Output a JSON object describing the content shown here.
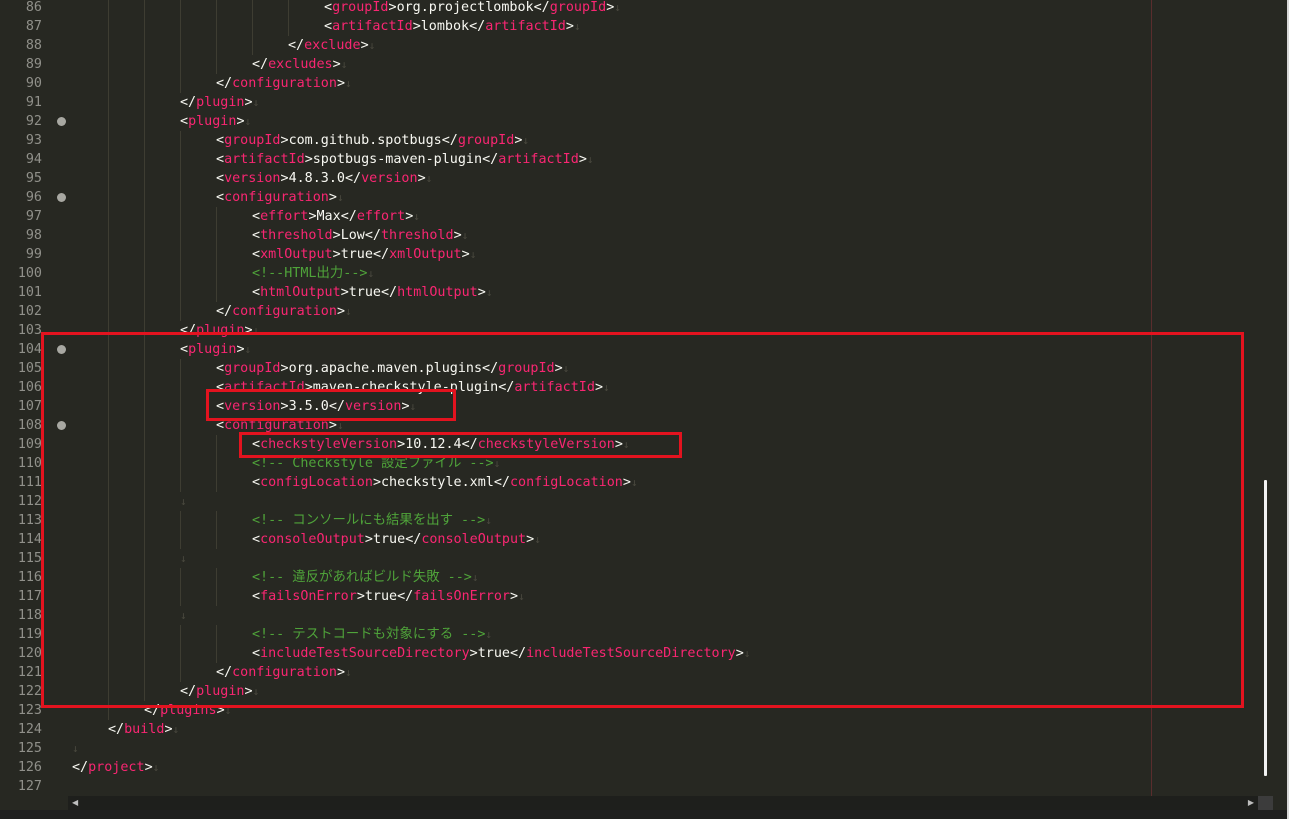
{
  "editor": {
    "lines": [
      {
        "n": "86",
        "indent": 7,
        "tokens": [
          [
            "b",
            "<"
          ],
          [
            "t",
            "groupId"
          ],
          [
            "b",
            ">"
          ],
          [
            "x",
            "org.projectlombok"
          ],
          [
            "b",
            "</"
          ],
          [
            "t",
            "groupId"
          ],
          [
            "b",
            ">"
          ]
        ]
      },
      {
        "n": "87",
        "indent": 7,
        "tokens": [
          [
            "b",
            "<"
          ],
          [
            "t",
            "artifactId"
          ],
          [
            "b",
            ">"
          ],
          [
            "x",
            "lombok"
          ],
          [
            "b",
            "</"
          ],
          [
            "t",
            "artifactId"
          ],
          [
            "b",
            ">"
          ]
        ]
      },
      {
        "n": "88",
        "indent": 6,
        "tokens": [
          [
            "b",
            "</"
          ],
          [
            "t",
            "exclude"
          ],
          [
            "b",
            ">"
          ]
        ]
      },
      {
        "n": "89",
        "indent": 5,
        "tokens": [
          [
            "b",
            "</"
          ],
          [
            "t",
            "excludes"
          ],
          [
            "b",
            ">"
          ]
        ]
      },
      {
        "n": "90",
        "indent": 4,
        "tokens": [
          [
            "b",
            "</"
          ],
          [
            "t",
            "configuration"
          ],
          [
            "b",
            ">"
          ]
        ]
      },
      {
        "n": "91",
        "indent": 3,
        "tokens": [
          [
            "b",
            "</"
          ],
          [
            "t",
            "plugin"
          ],
          [
            "b",
            ">"
          ]
        ]
      },
      {
        "n": "92",
        "indent": 3,
        "fold": true,
        "tokens": [
          [
            "b",
            "<"
          ],
          [
            "t",
            "plugin"
          ],
          [
            "b",
            ">"
          ]
        ]
      },
      {
        "n": "93",
        "indent": 4,
        "tokens": [
          [
            "b",
            "<"
          ],
          [
            "t",
            "groupId"
          ],
          [
            "b",
            ">"
          ],
          [
            "x",
            "com.github.spotbugs"
          ],
          [
            "b",
            "</"
          ],
          [
            "t",
            "groupId"
          ],
          [
            "b",
            ">"
          ]
        ]
      },
      {
        "n": "94",
        "indent": 4,
        "tokens": [
          [
            "b",
            "<"
          ],
          [
            "t",
            "artifactId"
          ],
          [
            "b",
            ">"
          ],
          [
            "x",
            "spotbugs-maven-plugin"
          ],
          [
            "b",
            "</"
          ],
          [
            "t",
            "artifactId"
          ],
          [
            "b",
            ">"
          ]
        ]
      },
      {
        "n": "95",
        "indent": 4,
        "tokens": [
          [
            "b",
            "<"
          ],
          [
            "t",
            "version"
          ],
          [
            "b",
            ">"
          ],
          [
            "x",
            "4.8.3.0"
          ],
          [
            "b",
            "</"
          ],
          [
            "t",
            "version"
          ],
          [
            "b",
            ">"
          ]
        ]
      },
      {
        "n": "96",
        "indent": 4,
        "fold": true,
        "tokens": [
          [
            "b",
            "<"
          ],
          [
            "t",
            "configuration"
          ],
          [
            "b",
            ">"
          ]
        ]
      },
      {
        "n": "97",
        "indent": 5,
        "tokens": [
          [
            "b",
            "<"
          ],
          [
            "t",
            "effort"
          ],
          [
            "b",
            ">"
          ],
          [
            "x",
            "Max"
          ],
          [
            "b",
            "</"
          ],
          [
            "t",
            "effort"
          ],
          [
            "b",
            ">"
          ]
        ]
      },
      {
        "n": "98",
        "indent": 5,
        "tokens": [
          [
            "b",
            "<"
          ],
          [
            "t",
            "threshold"
          ],
          [
            "b",
            ">"
          ],
          [
            "x",
            "Low"
          ],
          [
            "b",
            "</"
          ],
          [
            "t",
            "threshold"
          ],
          [
            "b",
            ">"
          ]
        ]
      },
      {
        "n": "99",
        "indent": 5,
        "tokens": [
          [
            "b",
            "<"
          ],
          [
            "t",
            "xmlOutput"
          ],
          [
            "b",
            ">"
          ],
          [
            "x",
            "true"
          ],
          [
            "b",
            "</"
          ],
          [
            "t",
            "xmlOutput"
          ],
          [
            "b",
            ">"
          ]
        ]
      },
      {
        "n": "100",
        "indent": 5,
        "tokens": [
          [
            "c",
            "<!--HTML出力-->"
          ]
        ]
      },
      {
        "n": "101",
        "indent": 5,
        "tokens": [
          [
            "b",
            "<"
          ],
          [
            "t",
            "htmlOutput"
          ],
          [
            "b",
            ">"
          ],
          [
            "x",
            "true"
          ],
          [
            "b",
            "</"
          ],
          [
            "t",
            "htmlOutput"
          ],
          [
            "b",
            ">"
          ]
        ]
      },
      {
        "n": "102",
        "indent": 4,
        "tokens": [
          [
            "b",
            "</"
          ],
          [
            "t",
            "configuration"
          ],
          [
            "b",
            ">"
          ]
        ]
      },
      {
        "n": "103",
        "indent": 3,
        "tokens": [
          [
            "b",
            "</"
          ],
          [
            "t",
            "plugin"
          ],
          [
            "b",
            ">"
          ]
        ]
      },
      {
        "n": "104",
        "indent": 3,
        "fold": true,
        "tokens": [
          [
            "b",
            "<"
          ],
          [
            "t",
            "plugin"
          ],
          [
            "b",
            ">"
          ]
        ]
      },
      {
        "n": "105",
        "indent": 4,
        "tokens": [
          [
            "b",
            "<"
          ],
          [
            "t",
            "groupId"
          ],
          [
            "b",
            ">"
          ],
          [
            "x",
            "org.apache.maven.plugins"
          ],
          [
            "b",
            "</"
          ],
          [
            "t",
            "groupId"
          ],
          [
            "b",
            ">"
          ]
        ]
      },
      {
        "n": "106",
        "indent": 4,
        "tokens": [
          [
            "b",
            "<"
          ],
          [
            "t",
            "artifactId"
          ],
          [
            "b",
            ">"
          ],
          [
            "x",
            "maven-checkstyle-plugin"
          ],
          [
            "b",
            "</"
          ],
          [
            "t",
            "artifactId"
          ],
          [
            "b",
            ">"
          ]
        ]
      },
      {
        "n": "107",
        "indent": 4,
        "tokens": [
          [
            "b",
            "<"
          ],
          [
            "t",
            "version"
          ],
          [
            "b",
            ">"
          ],
          [
            "x",
            "3.5.0"
          ],
          [
            "b",
            "</"
          ],
          [
            "t",
            "version"
          ],
          [
            "b",
            ">"
          ]
        ]
      },
      {
        "n": "108",
        "indent": 4,
        "fold": true,
        "tokens": [
          [
            "b",
            "<"
          ],
          [
            "t",
            "configuration"
          ],
          [
            "b",
            ">"
          ]
        ]
      },
      {
        "n": "109",
        "indent": 5,
        "tokens": [
          [
            "b",
            "<"
          ],
          [
            "t",
            "checkstyleVersion"
          ],
          [
            "b",
            ">"
          ],
          [
            "x",
            "10.12.4"
          ],
          [
            "b",
            "</"
          ],
          [
            "t",
            "checkstyleVersion"
          ],
          [
            "b",
            ">"
          ]
        ]
      },
      {
        "n": "110",
        "indent": 5,
        "tokens": [
          [
            "c",
            "<!-- Checkstyle 設定ファイル -->"
          ]
        ]
      },
      {
        "n": "111",
        "indent": 5,
        "tokens": [
          [
            "b",
            "<"
          ],
          [
            "t",
            "configLocation"
          ],
          [
            "b",
            ">"
          ],
          [
            "x",
            "checkstyle.xml"
          ],
          [
            "b",
            "</"
          ],
          [
            "t",
            "configLocation"
          ],
          [
            "b",
            ">"
          ]
        ]
      },
      {
        "n": "112",
        "indent": 3,
        "eolOnly": true,
        "tokens": []
      },
      {
        "n": "113",
        "indent": 5,
        "tokens": [
          [
            "c",
            "<!-- コンソールにも結果を出す -->"
          ]
        ]
      },
      {
        "n": "114",
        "indent": 5,
        "tokens": [
          [
            "b",
            "<"
          ],
          [
            "t",
            "consoleOutput"
          ],
          [
            "b",
            ">"
          ],
          [
            "x",
            "true"
          ],
          [
            "b",
            "</"
          ],
          [
            "t",
            "consoleOutput"
          ],
          [
            "b",
            ">"
          ]
        ]
      },
      {
        "n": "115",
        "indent": 3,
        "eolOnly": true,
        "tokens": []
      },
      {
        "n": "116",
        "indent": 5,
        "tokens": [
          [
            "c",
            "<!-- 違反があればビルド失敗 -->"
          ]
        ]
      },
      {
        "n": "117",
        "indent": 5,
        "tokens": [
          [
            "b",
            "<"
          ],
          [
            "t",
            "failsOnError"
          ],
          [
            "b",
            ">"
          ],
          [
            "x",
            "true"
          ],
          [
            "b",
            "</"
          ],
          [
            "t",
            "failsOnError"
          ],
          [
            "b",
            ">"
          ]
        ]
      },
      {
        "n": "118",
        "indent": 3,
        "eolOnly": true,
        "tokens": []
      },
      {
        "n": "119",
        "indent": 5,
        "tokens": [
          [
            "c",
            "<!-- テストコードも対象にする -->"
          ]
        ]
      },
      {
        "n": "120",
        "indent": 5,
        "tokens": [
          [
            "b",
            "<"
          ],
          [
            "t",
            "includeTestSourceDirectory"
          ],
          [
            "b",
            ">"
          ],
          [
            "x",
            "true"
          ],
          [
            "b",
            "</"
          ],
          [
            "t",
            "includeTestSourceDirectory"
          ],
          [
            "b",
            ">"
          ]
        ]
      },
      {
        "n": "121",
        "indent": 4,
        "tokens": [
          [
            "b",
            "</"
          ],
          [
            "t",
            "configuration"
          ],
          [
            "b",
            ">"
          ]
        ]
      },
      {
        "n": "122",
        "indent": 3,
        "tokens": [
          [
            "b",
            "</"
          ],
          [
            "t",
            "plugin"
          ],
          [
            "b",
            ">"
          ]
        ]
      },
      {
        "n": "123",
        "indent": 2,
        "tokens": [
          [
            "b",
            "</"
          ],
          [
            "t",
            "plugins"
          ],
          [
            "b",
            ">"
          ]
        ]
      },
      {
        "n": "124",
        "indent": 1,
        "tokens": [
          [
            "b",
            "</"
          ],
          [
            "t",
            "build"
          ],
          [
            "b",
            ">"
          ]
        ]
      },
      {
        "n": "125",
        "indent": 0,
        "eolOnly": true,
        "tokens": []
      },
      {
        "n": "126",
        "indent": 0,
        "tokens": [
          [
            "b",
            "</"
          ],
          [
            "t",
            "project"
          ],
          [
            "b",
            ">"
          ]
        ]
      },
      {
        "n": "127",
        "indent": 0,
        "noEol": true,
        "tokens": []
      }
    ],
    "eol_glyph": "↓",
    "colors": {
      "background": "#272822",
      "tag": "#f92672",
      "text": "#f8f8f2",
      "comment": "#4fa33a",
      "line_number": "#90908a",
      "highlight_box": "#e3131f"
    }
  },
  "highlights": [
    {
      "label": "plugin-block-box"
    },
    {
      "label": "version-box"
    },
    {
      "label": "checkstyle-version-box"
    }
  ]
}
